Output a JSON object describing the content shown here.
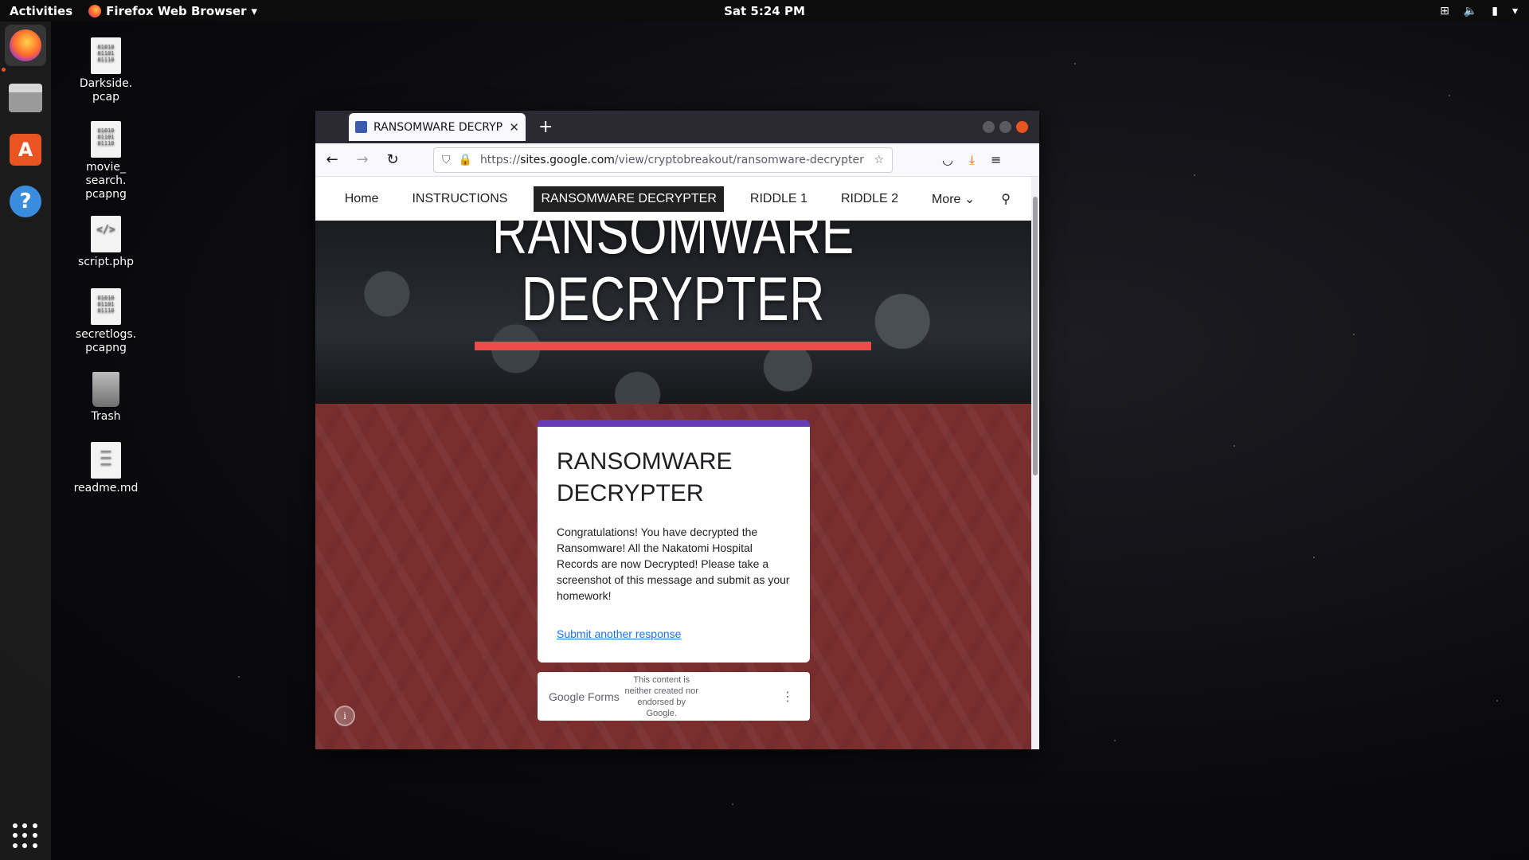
{
  "topbar": {
    "activities": "Activities",
    "app_name": "Firefox Web Browser",
    "clock": "Sat  5:24 PM"
  },
  "desktop": {
    "icons": [
      {
        "label": "Darkside.\npcap",
        "icon": "pcap-file-icon"
      },
      {
        "label": "movie_\nsearch.\npcapng",
        "icon": "pcap-file-icon"
      },
      {
        "label": "script.php",
        "icon": "code-file-icon"
      },
      {
        "label": "secretlogs.\npcapng",
        "icon": "pcap-file-icon"
      },
      {
        "label": "Trash",
        "icon": "trash-icon"
      },
      {
        "label": "readme.md",
        "icon": "text-file-icon"
      }
    ]
  },
  "browser": {
    "tab_title": "RANSOMWARE DECRYPTER",
    "url_prefix": "https://",
    "url_host": "sites.google.com",
    "url_path": "/view/cryptobreakout/ransomware-decrypter"
  },
  "site": {
    "nav": [
      "Home",
      "INSTRUCTIONS",
      "RANSOMWARE DECRYPTER",
      "RIDDLE 1",
      "RIDDLE 2",
      "More"
    ],
    "active_nav": 2,
    "hero_title_line1": "RANSOMWARE",
    "hero_title_line2": "DECRYPTER",
    "accent_color": "#ee4b4b",
    "form": {
      "title_line1": "RANSOMWARE",
      "title_line2": "DECRYPTER",
      "message": "Congratulations!  You have decrypted the Ransomware!  All the Nakatomi Hospital Records are now Decrypted!  Please take a screenshot of this message and submit as your homework!",
      "link": "Submit another response",
      "header_color": "#673ab7"
    },
    "footer": {
      "brand": "Google Forms",
      "note": "This content is neither created nor endorsed by Google."
    }
  }
}
